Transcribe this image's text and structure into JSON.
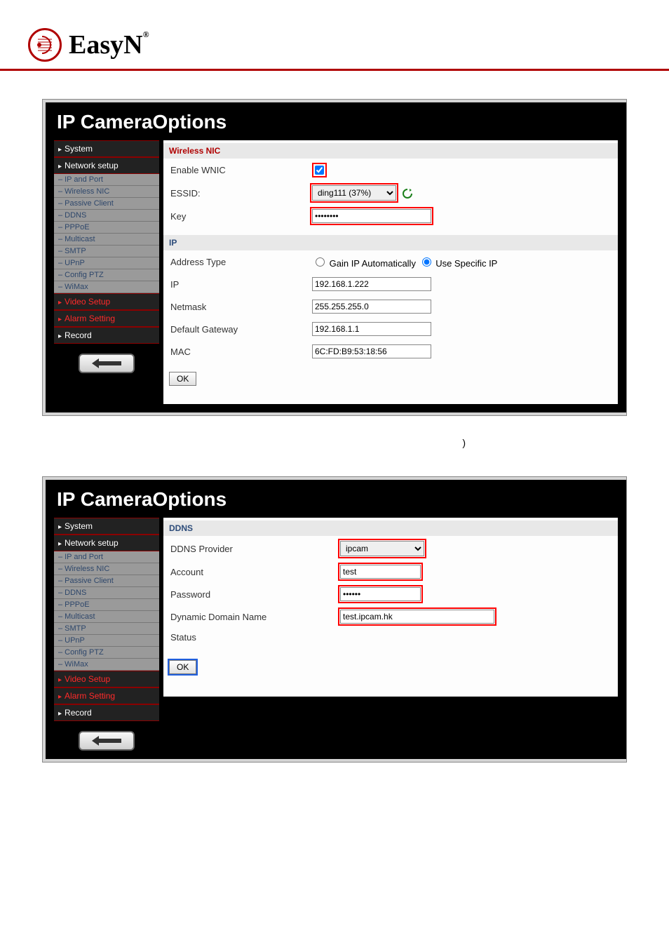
{
  "brand": "EasyN",
  "brand_reg": "®",
  "stray_text": ")",
  "panel1": {
    "title": "IP CameraOptions",
    "sidebar": {
      "cats": [
        {
          "label": "System",
          "class": "nav-cat",
          "name": "nav-system"
        },
        {
          "label": "Network setup",
          "class": "nav-cat expanded",
          "name": "nav-network-setup"
        },
        {
          "label": "IP and Port",
          "class": "sub-item",
          "name": "sub-ip-and-port"
        },
        {
          "label": "Wireless NIC",
          "class": "sub-item",
          "name": "sub-wireless-nic"
        },
        {
          "label": "Passive Client",
          "class": "sub-item",
          "name": "sub-passive-client"
        },
        {
          "label": "DDNS",
          "class": "sub-item",
          "name": "sub-ddns"
        },
        {
          "label": "PPPoE",
          "class": "sub-item",
          "name": "sub-pppoe"
        },
        {
          "label": "Multicast",
          "class": "sub-item",
          "name": "sub-multicast"
        },
        {
          "label": "SMTP",
          "class": "sub-item",
          "name": "sub-smtp"
        },
        {
          "label": "UPnP",
          "class": "sub-item",
          "name": "sub-upnp"
        },
        {
          "label": "Config PTZ",
          "class": "sub-item",
          "name": "sub-config-ptz"
        },
        {
          "label": "WiMax",
          "class": "sub-item",
          "name": "sub-wimax"
        },
        {
          "label": "Video Setup",
          "class": "nav-cat danger",
          "name": "nav-video-setup"
        },
        {
          "label": "Alarm Setting",
          "class": "nav-cat danger",
          "name": "nav-alarm-setting"
        },
        {
          "label": "Record",
          "class": "nav-cat",
          "name": "nav-record"
        }
      ]
    },
    "wireless": {
      "header": "Wireless NIC",
      "enable_label": "Enable WNIC",
      "enable_checked": true,
      "essid_label": "ESSID:",
      "essid_value": "ding111 (37%)",
      "key_label": "Key",
      "key_value": "••••••••"
    },
    "ip": {
      "header": "IP",
      "address_type_label": "Address Type",
      "radio1_label": "Gain IP Automatically",
      "radio2_label": "Use Specific IP",
      "radio_selected": "specific",
      "ip_label": "IP",
      "ip_value": "192.168.1.222",
      "netmask_label": "Netmask",
      "netmask_value": "255.255.255.0",
      "gateway_label": "Default Gateway",
      "gateway_value": "192.168.1.1",
      "mac_label": "MAC",
      "mac_value": "6C:FD:B9:53:18:56"
    },
    "ok_label": "OK"
  },
  "panel2": {
    "title": "IP CameraOptions",
    "sidebar": {
      "cats": [
        {
          "label": "System",
          "class": "nav-cat",
          "name": "nav2-system"
        },
        {
          "label": "Network setup",
          "class": "nav-cat expanded",
          "name": "nav2-network-setup"
        },
        {
          "label": "IP and Port",
          "class": "sub-item",
          "name": "sub2-ip-and-port"
        },
        {
          "label": "Wireless NIC",
          "class": "sub-item",
          "name": "sub2-wireless-nic"
        },
        {
          "label": "Passive Client",
          "class": "sub-item",
          "name": "sub2-passive-client"
        },
        {
          "label": "DDNS",
          "class": "sub-item",
          "name": "sub2-ddns"
        },
        {
          "label": "PPPoE",
          "class": "sub-item",
          "name": "sub2-pppoe"
        },
        {
          "label": "Multicast",
          "class": "sub-item",
          "name": "sub2-multicast"
        },
        {
          "label": "SMTP",
          "class": "sub-item",
          "name": "sub2-smtp"
        },
        {
          "label": "UPnP",
          "class": "sub-item",
          "name": "sub2-upnp"
        },
        {
          "label": "Config PTZ",
          "class": "sub-item",
          "name": "sub2-config-ptz"
        },
        {
          "label": "WiMax",
          "class": "sub-item",
          "name": "sub2-wimax"
        },
        {
          "label": "Video Setup",
          "class": "nav-cat danger",
          "name": "nav2-video-setup"
        },
        {
          "label": "Alarm Setting",
          "class": "nav-cat danger",
          "name": "nav2-alarm-setting"
        },
        {
          "label": "Record",
          "class": "nav-cat",
          "name": "nav2-record"
        }
      ]
    },
    "ddns": {
      "header": "DDNS",
      "provider_label": "DDNS Provider",
      "provider_value": "ipcam",
      "account_label": "Account",
      "account_value": "test",
      "password_label": "Password",
      "password_value": "••••••",
      "domain_label": "Dynamic Domain Name",
      "domain_value": "test.ipcam.hk",
      "status_label": "Status"
    },
    "ok_label": "OK"
  }
}
